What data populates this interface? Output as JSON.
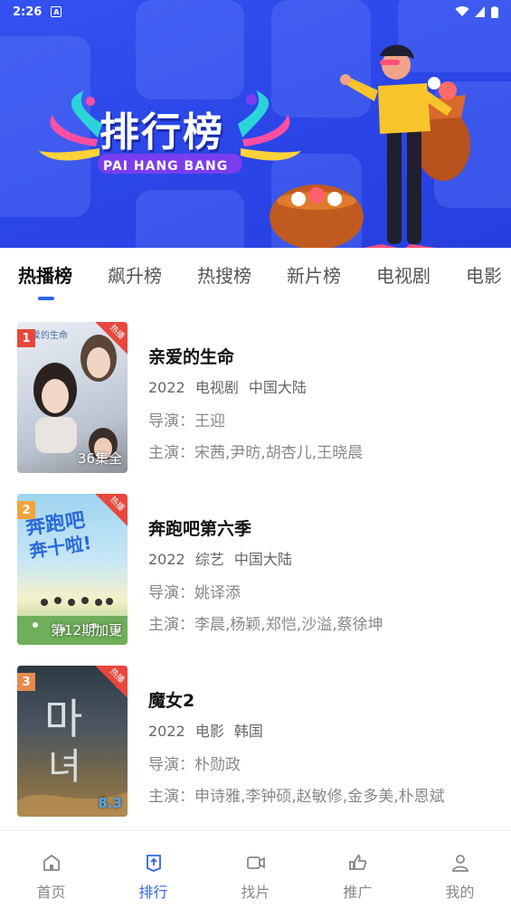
{
  "status": {
    "time": "2:26",
    "notif": "A"
  },
  "banner": {
    "title": "排行榜",
    "subtitle": "PAI HANG BANG"
  },
  "tabs": [
    "热播榜",
    "飙升榜",
    "热搜榜",
    "新片榜",
    "电视剧",
    "电影"
  ],
  "active_tab": 0,
  "items": [
    {
      "rank": "1",
      "title": "亲爱的生命",
      "year": "2022",
      "type": "电视剧",
      "region": "中国大陆",
      "director": "导演：王迎",
      "cast": "主演：宋茜,尹昉,胡杏儿,王晓晨",
      "badge": "36集全",
      "hot": "热播",
      "rank_color": "#e8473d"
    },
    {
      "rank": "2",
      "title": "奔跑吧第六季",
      "year": "2022",
      "type": "综艺",
      "region": "中国大陆",
      "director": "导演：姚译添",
      "cast": "主演：李晨,杨颖,郑恺,沙溢,蔡徐坤",
      "badge": "第12期加更",
      "hot": "热播",
      "rank_color": "#f2a33a"
    },
    {
      "rank": "3",
      "title": "魔女2",
      "year": "2022",
      "type": "电影",
      "region": "韩国",
      "director": "导演：朴勋政",
      "cast": "主演：申诗雅,李钟硕,赵敏修,金多美,朴恩斌",
      "badge": "8.3",
      "hot": "热播",
      "rank_color": "#e88a4c"
    }
  ],
  "nav": [
    {
      "label": "首页",
      "icon": "home-icon"
    },
    {
      "label": "排行",
      "icon": "ranking-icon"
    },
    {
      "label": "找片",
      "icon": "video-icon"
    },
    {
      "label": "推广",
      "icon": "thumbs-up-icon"
    },
    {
      "label": "我的",
      "icon": "user-icon"
    }
  ],
  "colors": {
    "accent": "#2f64e8",
    "banner": "#2e4ae8"
  }
}
